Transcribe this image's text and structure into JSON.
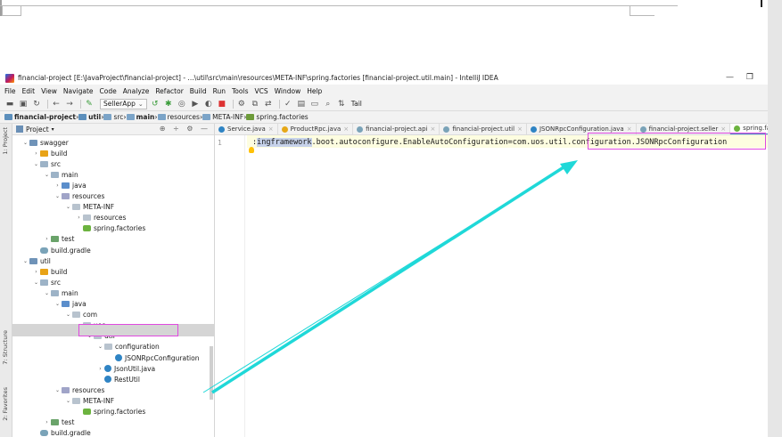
{
  "window": {
    "title": "financial-project [E:\\JavaProject\\financial-project] - ...\\util\\src\\main\\resources\\META-INF\\spring.factories [financial-project.util.main] - IntelliJ IDEA",
    "minimize": "—",
    "maximize": "❐"
  },
  "menu": [
    "File",
    "Edit",
    "View",
    "Navigate",
    "Code",
    "Analyze",
    "Refactor",
    "Build",
    "Run",
    "Tools",
    "VCS",
    "Window",
    "Help"
  ],
  "toolbar": {
    "run_config": "SellerApp",
    "tail_label": "Tail"
  },
  "breadcrumb": [
    "financial-project",
    "util",
    "src",
    "main",
    "resources",
    "META-INF",
    "spring.factories"
  ],
  "project_panel": {
    "title": "Project",
    "tree": [
      {
        "label": "swagger",
        "depth": 0,
        "arrow": "⌄",
        "icon": "mod"
      },
      {
        "label": "build",
        "depth": 1,
        "arrow": "›",
        "icon": "build"
      },
      {
        "label": "src",
        "depth": 1,
        "arrow": "⌄",
        "icon": "src"
      },
      {
        "label": "main",
        "depth": 2,
        "arrow": "⌄",
        "icon": "src"
      },
      {
        "label": "java",
        "depth": 3,
        "arrow": "›",
        "icon": "srcroot"
      },
      {
        "label": "resources",
        "depth": 3,
        "arrow": "⌄",
        "icon": "res"
      },
      {
        "label": "META-INF",
        "depth": 4,
        "arrow": "⌄",
        "icon": "pkg"
      },
      {
        "label": "resources",
        "depth": 5,
        "arrow": "›",
        "icon": "pkg"
      },
      {
        "label": "spring.factories",
        "depth": 5,
        "arrow": "",
        "icon": "spring"
      },
      {
        "label": "test",
        "depth": 2,
        "arrow": "›",
        "icon": "test"
      },
      {
        "label": "build.gradle",
        "depth": 1,
        "arrow": "",
        "icon": "gradle"
      },
      {
        "label": "util",
        "depth": 0,
        "arrow": "⌄",
        "icon": "mod"
      },
      {
        "label": "build",
        "depth": 1,
        "arrow": "›",
        "icon": "build"
      },
      {
        "label": "src",
        "depth": 1,
        "arrow": "⌄",
        "icon": "src"
      },
      {
        "label": "main",
        "depth": 2,
        "arrow": "⌄",
        "icon": "src"
      },
      {
        "label": "java",
        "depth": 3,
        "arrow": "⌄",
        "icon": "srcroot"
      },
      {
        "label": "com",
        "depth": 4,
        "arrow": "⌄",
        "icon": "pkg"
      },
      {
        "label": "uos",
        "depth": 5,
        "arrow": "⌄",
        "icon": "pkg"
      },
      {
        "label": "util",
        "depth": 6,
        "arrow": "⌄",
        "icon": "pkg"
      },
      {
        "label": "configuration",
        "depth": 7,
        "arrow": "⌄",
        "icon": "pkg"
      },
      {
        "label": "JSONRpcConfiguration",
        "depth": 8,
        "arrow": "",
        "icon": "class"
      },
      {
        "label": "JsonUtil.java",
        "depth": 7,
        "arrow": "›",
        "icon": "class"
      },
      {
        "label": "RestUtil",
        "depth": 7,
        "arrow": "",
        "icon": "class"
      },
      {
        "label": "resources",
        "depth": 3,
        "arrow": "⌄",
        "icon": "res"
      },
      {
        "label": "META-INF",
        "depth": 4,
        "arrow": "⌄",
        "icon": "pkg"
      },
      {
        "label": "spring.factories",
        "depth": 5,
        "arrow": "",
        "icon": "spring"
      },
      {
        "label": "test",
        "depth": 2,
        "arrow": "›",
        "icon": "test"
      },
      {
        "label": "build.gradle",
        "depth": 1,
        "arrow": "",
        "icon": "gradle"
      }
    ]
  },
  "side_tabs": {
    "project": "1: Project",
    "structure": "7: Structure",
    "favorites": "2: Favorites"
  },
  "editor": {
    "tabs": [
      {
        "label": "Service.java",
        "icon": "#2f84c4"
      },
      {
        "label": "ProductRpc.java",
        "icon": "#e6a817"
      },
      {
        "label": "financial-project.api",
        "icon": "#7aa3b8"
      },
      {
        "label": "financial-project.util",
        "icon": "#7aa3b8"
      },
      {
        "label": "JSONRpcConfiguration.java",
        "icon": "#2f84c4"
      },
      {
        "label": "financial-project.seller",
        "icon": "#7aa3b8"
      },
      {
        "label": "spring.factories",
        "icon": "#6cb33f"
      }
    ],
    "line_number": "1",
    "code_prefix": ":",
    "code_selected": "ingframework",
    "code_rest": ".boot.autoconfigure.EnableAutoConfiguration=com.uos.util.configuration.JSONRpcConfiguration"
  },
  "colors": {
    "highlight_box": "#e04ae0",
    "arrow": "#1fd8d8"
  }
}
